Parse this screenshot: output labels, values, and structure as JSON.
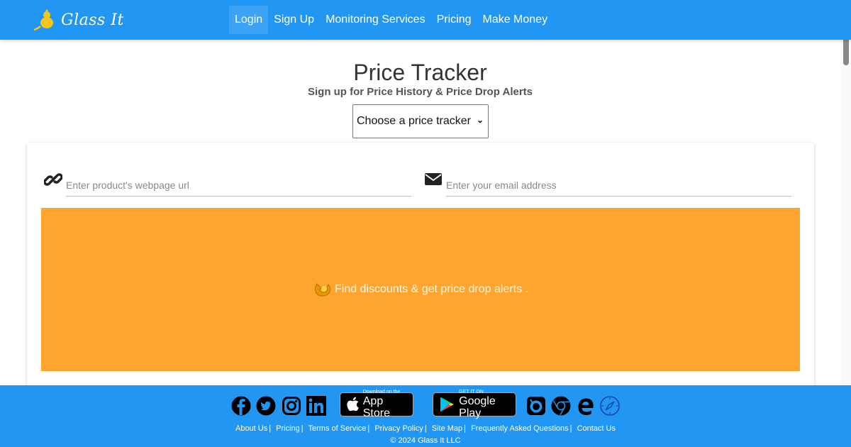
{
  "header": {
    "brand": "Glass It",
    "nav": [
      {
        "label": "Login",
        "active": true
      },
      {
        "label": "Sign Up"
      },
      {
        "label": "Monitoring Services"
      },
      {
        "label": "Pricing"
      },
      {
        "label": "Make Money"
      }
    ]
  },
  "main": {
    "title": "Price Tracker",
    "subtitle": "Sign up for Price History & Price Drop Alerts",
    "tracker_select": {
      "selected": "Choose a price tracker"
    },
    "url_input": {
      "placeholder": "Enter product's webpage url",
      "value": "",
      "icon": "link-icon"
    },
    "email_input": {
      "placeholder": "Enter your email address",
      "value": "",
      "icon": "envelope-icon"
    },
    "banner": {
      "text": "Find discounts & get price drop alerts .",
      "icon": "arrow-icon",
      "color": "#ffa42f"
    }
  },
  "footer": {
    "social": [
      "facebook-icon",
      "twitter-icon",
      "instagram-icon",
      "linkedin-icon"
    ],
    "app_store": {
      "small": "Download on the",
      "big": "App Store"
    },
    "google_play": {
      "small": "GET IT ON",
      "big": "Google Play"
    },
    "browsers": [
      "firefox-icon",
      "chrome-icon",
      "edge-icon",
      "safari-icon"
    ],
    "links": [
      "About Us",
      "Pricing",
      "Terms of Service",
      "Privacy Policy",
      "Site Map",
      "Frequently Asked Questions",
      "Contact Us"
    ],
    "copyright": "© 2024 Glass It LLC"
  },
  "colors": {
    "brand": "#2196f3",
    "banner": "#ffa42f"
  }
}
